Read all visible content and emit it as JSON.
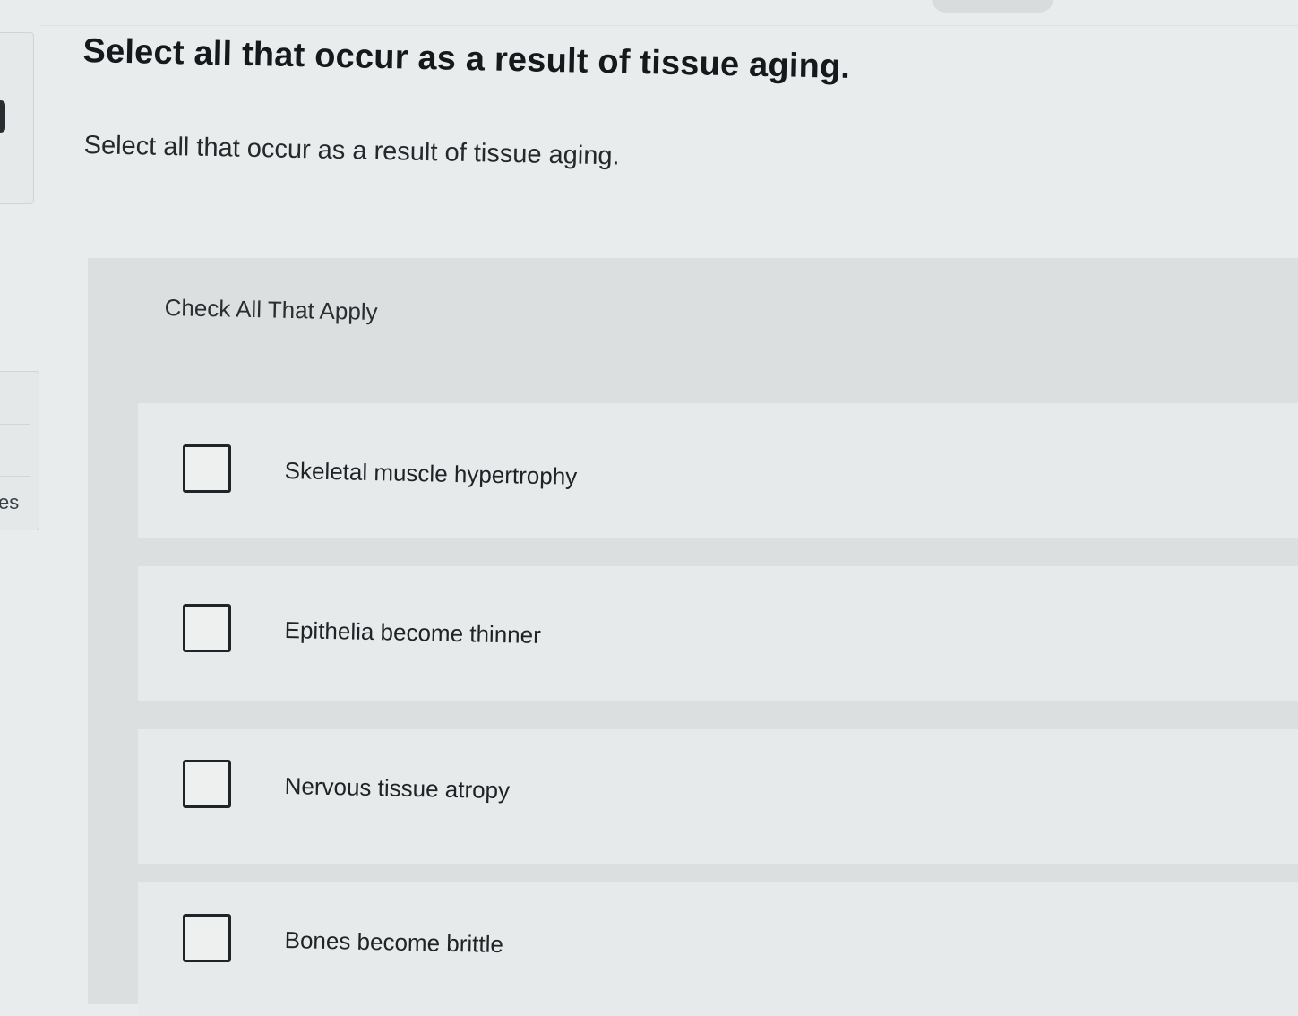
{
  "sidebar": {
    "partial_label": "es"
  },
  "question": {
    "title": "Select all that occur as a result of tissue aging.",
    "prompt": "Select all that occur as a result of tissue aging.",
    "instruction": "Check All That Apply",
    "options": [
      {
        "label": "Skeletal muscle hypertrophy",
        "checked": false
      },
      {
        "label": "Epithelia become thinner",
        "checked": false
      },
      {
        "label": "Nervous tissue atropy",
        "checked": false
      },
      {
        "label": "Bones become brittle",
        "checked": false
      }
    ]
  },
  "colors": {
    "background": "#e9ecec",
    "panel": "#dcdfdf",
    "option_row": "#e7eaea",
    "text": "#1f2326",
    "checkbox_border": "#202427"
  }
}
